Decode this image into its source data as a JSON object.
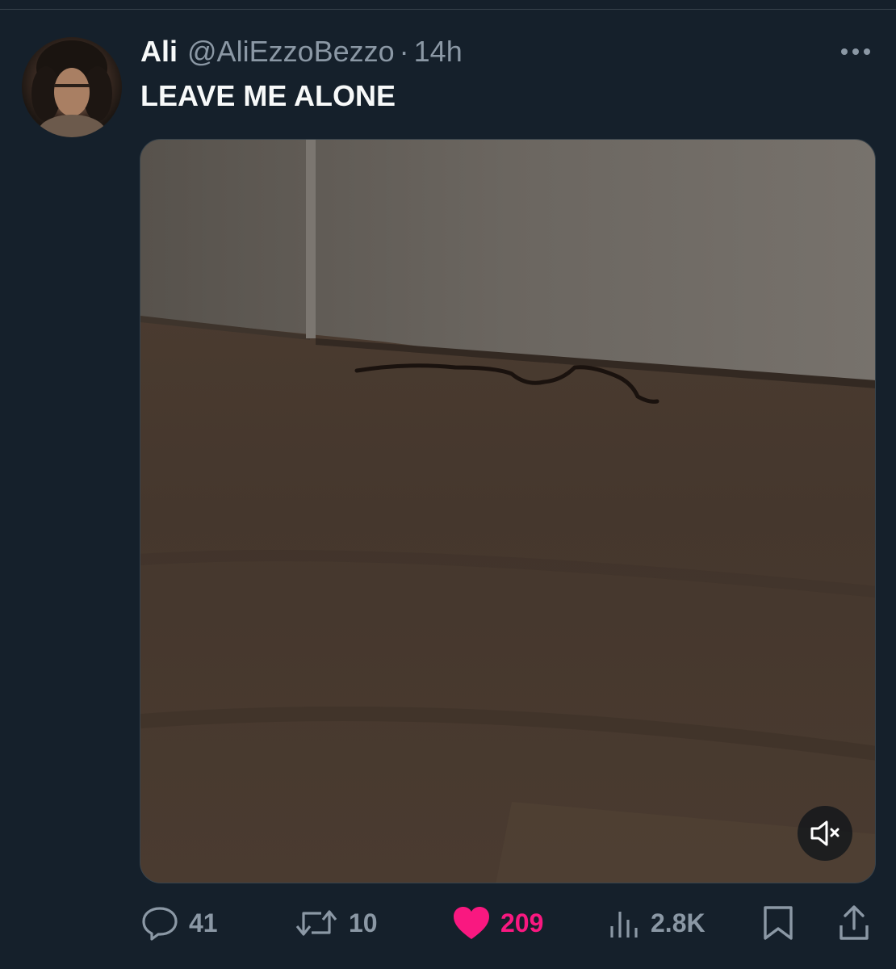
{
  "tweet": {
    "display_name": "Ali",
    "handle": "@AliEzzoBezzo",
    "separator": "·",
    "time": "14h",
    "text": "LEAVE ME ALONE"
  },
  "media": {
    "type": "video",
    "muted": true,
    "mute_icon": "speaker-muted-icon"
  },
  "actions": {
    "replies": "41",
    "retweets": "10",
    "likes": "209",
    "views": "2.8K",
    "liked": true
  },
  "colors": {
    "background": "#15202b",
    "primary_text": "#f7f9f9",
    "secondary_text": "#8b98a5",
    "like_accent": "#f91880",
    "border": "#38444d"
  }
}
